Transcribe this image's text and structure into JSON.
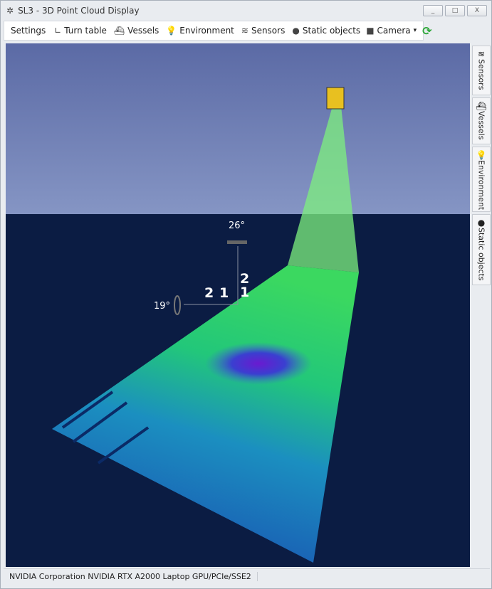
{
  "window": {
    "title": "SL3 - 3D Point Cloud Display",
    "minimize": "_",
    "maximize": "□",
    "close": "X"
  },
  "toolbar": {
    "settings": "Settings",
    "turn_table": "Turn table",
    "vessels": "Vessels",
    "environment": "Environment",
    "sensors": "Sensors",
    "static_objects": "Static objects",
    "camera": "Camera",
    "camera_arrow": "▾",
    "refresh": "⟳"
  },
  "side_tabs": [
    {
      "label": "Sensors"
    },
    {
      "label": "Vessels"
    },
    {
      "label": "Environment"
    },
    {
      "label": "Static objects"
    }
  ],
  "viewport": {
    "pitch_angle": "26°",
    "roll_angle": "19°",
    "scale_x_2": "2",
    "scale_x_1": "1",
    "scale_y_2": "2",
    "scale_y_1": "1"
  },
  "colors": {
    "sky": "#6474ab",
    "water": "#0b1c43",
    "beam": "#7ef07e",
    "refresh": "#2fa83a"
  },
  "status": {
    "renderer": "NVIDIA Corporation NVIDIA RTX A2000 Laptop GPU/PCIe/SSE2"
  }
}
